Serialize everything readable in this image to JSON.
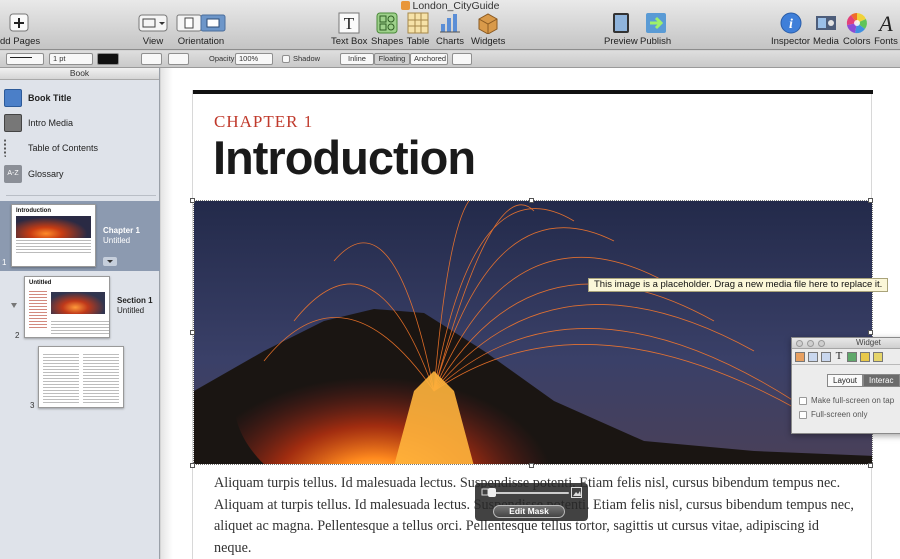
{
  "window": {
    "title": "London_CityGuide"
  },
  "toolbar": {
    "add_pages": "dd Pages",
    "view": "View",
    "orientation": "Orientation",
    "text_box": "Text Box",
    "shapes": "Shapes",
    "table": "Table",
    "charts": "Charts",
    "widgets": "Widgets",
    "preview": "Preview",
    "publish": "Publish",
    "inspector": "Inspector",
    "media": "Media",
    "colors": "Colors",
    "fonts": "Fonts"
  },
  "format_bar": {
    "stroke_width": "1 pt",
    "opacity_label": "Opacity:",
    "opacity_value": "100%",
    "shadow_label": "Shadow",
    "wrap_inline": "Inline",
    "wrap_floating": "Floating",
    "wrap_anchored": "Anchored"
  },
  "sidebar": {
    "header": "Book",
    "items": [
      {
        "label": "Book Title",
        "icon": "book-icon"
      },
      {
        "label": "Intro Media",
        "icon": "film-icon"
      },
      {
        "label": "Table of Contents",
        "icon": "list-icon"
      },
      {
        "label": "Glossary",
        "icon": "az-icon"
      }
    ],
    "thumbnails": [
      {
        "page": "1",
        "title": "Chapter 1",
        "subtitle": "Untitled",
        "thumb_heading": "Introduction"
      },
      {
        "page": "2",
        "title": "Section 1",
        "subtitle": "Untitled",
        "thumb_heading": "Untitled"
      },
      {
        "page": "3",
        "title": "",
        "subtitle": "",
        "thumb_heading": ""
      }
    ]
  },
  "page": {
    "chapter_label": "CHAPTER 1",
    "title": "Introduction",
    "body": "Aliquam turpis tellus. Id malesuada lectus. Suspendisse potenti. Etiam felis nisl, cursus bibendum tempus nec. Aliquam at turpis tellus. Id malesuada lectus. Suspendisse potenti. Etiam felis nisl, cursus bibendum tempus nec, aliquet ac magna. Pellentesque a tellus orci. Pellentesque tellus tortor, sagittis ut cursus vitae, adipiscing id neque."
  },
  "tooltip": {
    "text": "This image is a placeholder. Drag a new media file here to replace it."
  },
  "widget_panel": {
    "title": "Widget",
    "tab_layout": "Layout",
    "tab_interaction": "Interac",
    "option_fullscreen_tap": "Make full-screen on tap",
    "option_fullscreen_only": "Full-screen only"
  },
  "mask_hud": {
    "button": "Edit Mask"
  },
  "colors": {
    "chapter_red": "#c0392b",
    "sidebar_bg": "#dfe3ea",
    "selected_row": "#8c9ab0"
  }
}
